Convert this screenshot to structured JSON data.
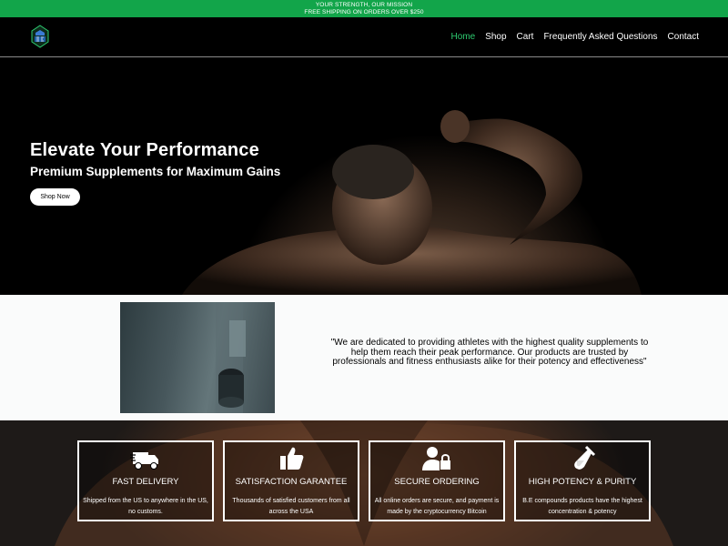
{
  "announcement": {
    "line1": "YOUR STRENGTH, OUR MISSION",
    "line2": "FREE SHIPPING ON ORDERS OVER $250"
  },
  "nav": {
    "items": [
      {
        "label": "Home",
        "active": true
      },
      {
        "label": "Shop"
      },
      {
        "label": "Cart"
      },
      {
        "label": "Frequently Asked Questions"
      },
      {
        "label": "Contact"
      }
    ]
  },
  "hero": {
    "title": "Elevate Your Performance",
    "subtitle": "Premium Supplements for Maximum Gains",
    "button": "Shop Now"
  },
  "about": {
    "quote": "\"We are dedicated to providing athletes with the highest quality supplements to help them reach their peak performance. Our products are trusted by professionals and fitness enthusiasts alike for their potency and effectiveness\""
  },
  "features": [
    {
      "icon": "delivery-truck-icon",
      "title": "FAST DELIVERY",
      "description": "Shipped from the US to anywhere in the US, no customs."
    },
    {
      "icon": "thumbs-up-icon",
      "title": "SATISFACTION GARANTEE",
      "description": "Thousands of satisfied customers from all across the USA"
    },
    {
      "icon": "user-lock-icon",
      "title": "SECURE ORDERING",
      "description": "All online orders are secure, and payment is made by the cryptocurrency Bitcoin"
    },
    {
      "icon": "test-tube-icon",
      "title": "HIGH POTENCY & PURITY",
      "description": "B.E compounds products have the highest concentration & potency"
    }
  ],
  "colors": {
    "accent": "#12a54a",
    "nav_active": "#2ecc71"
  }
}
